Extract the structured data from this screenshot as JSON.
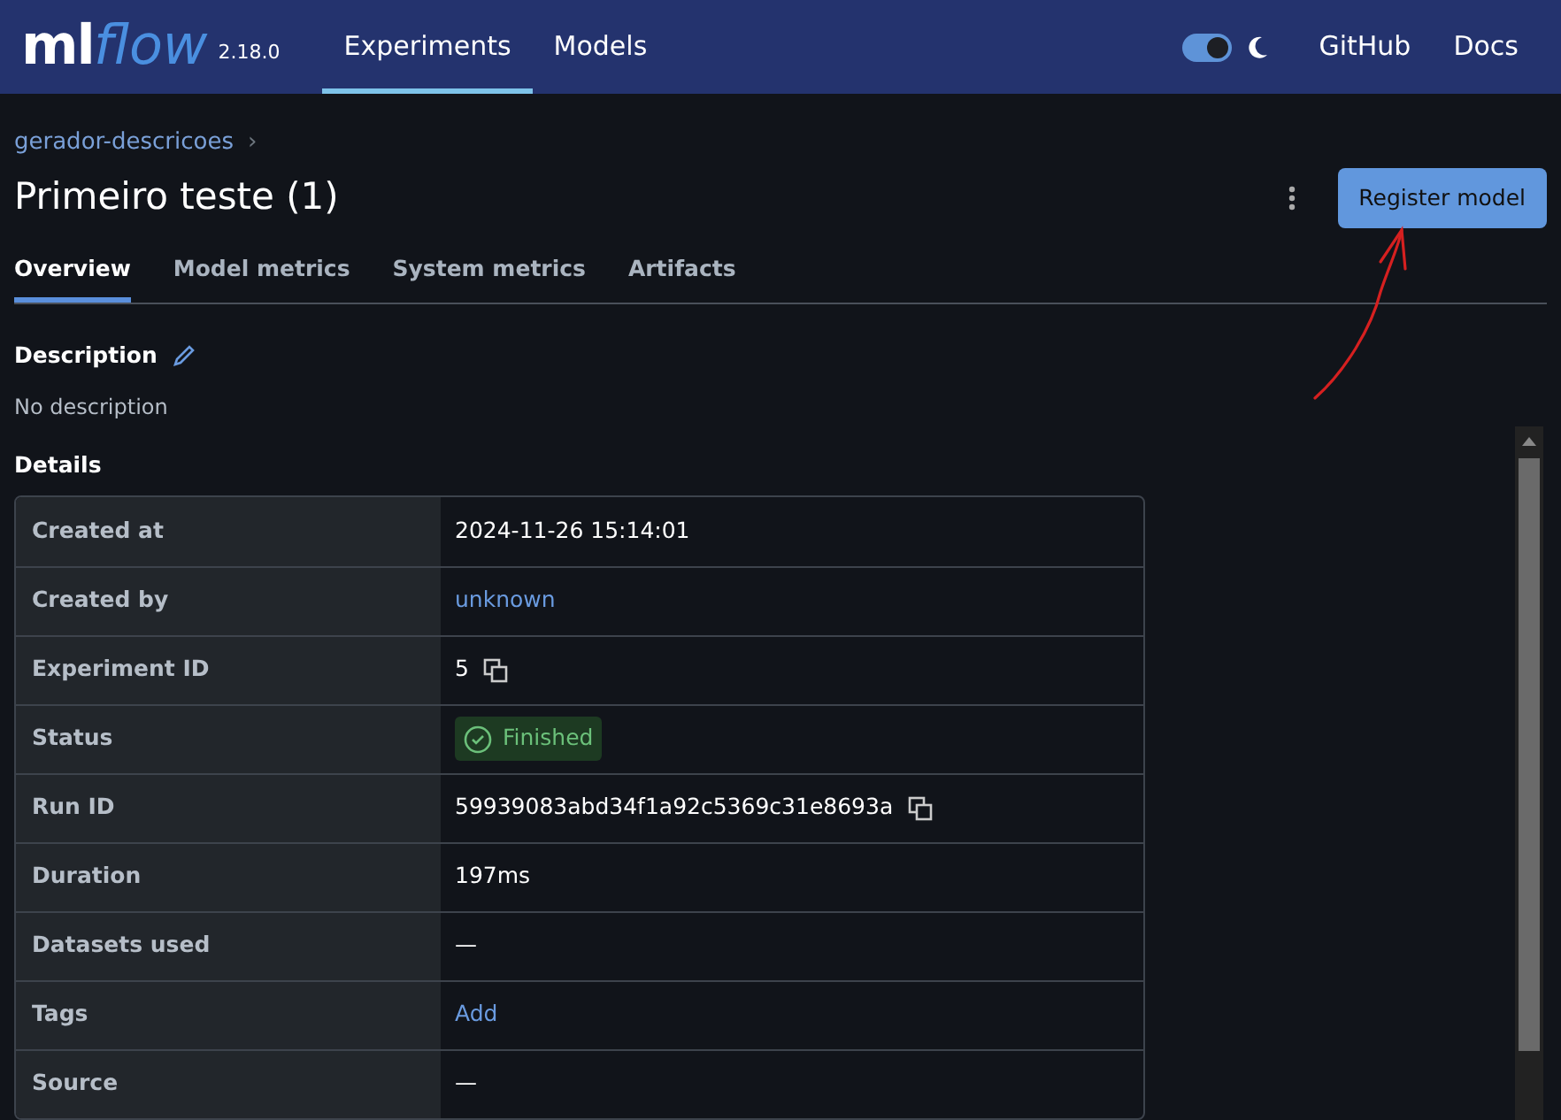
{
  "navbar": {
    "logo": {
      "ml": "ml",
      "flow": "flow"
    },
    "version": "2.18.0",
    "links": [
      {
        "label": "Experiments",
        "selected": true
      },
      {
        "label": "Models",
        "selected": false
      }
    ],
    "dark_mode_toggle": {
      "on": true
    },
    "right_links": [
      "GitHub",
      "Docs"
    ]
  },
  "breadcrumb": "gerador-descricoes",
  "chevron": "›",
  "title": "Primeiro teste (1)",
  "register_button": "Register model",
  "tabs": [
    {
      "label": "Overview",
      "selected": true
    },
    {
      "label": "Model metrics",
      "selected": false
    },
    {
      "label": "System metrics",
      "selected": false
    },
    {
      "label": "Artifacts",
      "selected": false
    }
  ],
  "description": {
    "heading": "Description",
    "text": "No description"
  },
  "details": {
    "heading": "Details",
    "rows": [
      {
        "label": "Created at",
        "value": "2024-11-26 15:14:01",
        "kind": "text"
      },
      {
        "label": "Created by",
        "value": "unknown",
        "kind": "link"
      },
      {
        "label": "Experiment ID",
        "value": "5",
        "kind": "copy"
      },
      {
        "label": "Status",
        "value": "Finished",
        "kind": "status"
      },
      {
        "label": "Run ID",
        "value": "59939083abd34f1a92c5369c31e8693a",
        "kind": "copy"
      },
      {
        "label": "Duration",
        "value": "197ms",
        "kind": "text"
      },
      {
        "label": "Datasets used",
        "value": "—",
        "kind": "text"
      },
      {
        "label": "Tags",
        "value": "Add",
        "kind": "link"
      },
      {
        "label": "Source",
        "value": "—",
        "kind": "text"
      }
    ]
  }
}
